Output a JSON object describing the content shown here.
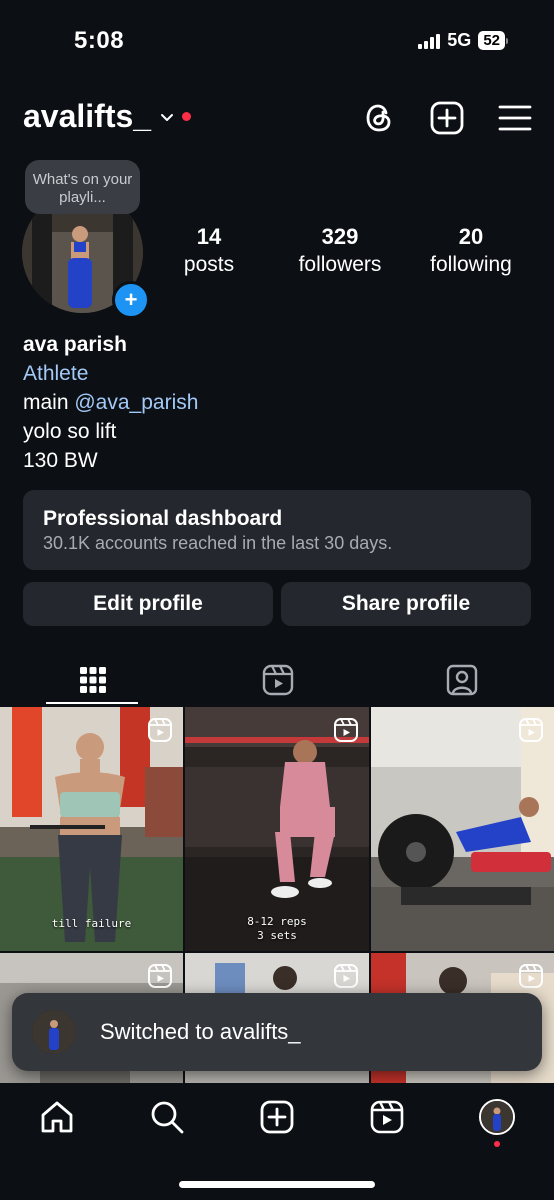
{
  "status_bar": {
    "time": "5:08",
    "network": "5G",
    "battery": "52"
  },
  "header": {
    "username": "avalifts_",
    "icons": [
      "threads-icon",
      "create-post-icon",
      "menu-icon"
    ]
  },
  "profile": {
    "note": "What's on your playli...",
    "stats": [
      {
        "value": "14",
        "label": "posts"
      },
      {
        "value": "329",
        "label": "followers"
      },
      {
        "value": "20",
        "label": "following"
      }
    ],
    "name": "ava parish",
    "category": "Athlete",
    "bio_main_prefix": "main ",
    "bio_mention": "@ava_parish",
    "bio_line2": "yolo so lift",
    "bio_line3": "130 BW"
  },
  "dashboard": {
    "title": "Professional dashboard",
    "subtitle": "30.1K accounts reached in the last 30 days."
  },
  "buttons": {
    "edit_profile": "Edit profile",
    "share_profile": "Share profile"
  },
  "tabs": [
    "grid-tab",
    "reels-tab",
    "tagged-tab"
  ],
  "grid": {
    "captions": {
      "tile1": "till failure",
      "tile2_line1": "8-12 reps",
      "tile2_line2": "3 sets"
    }
  },
  "toast": {
    "message": "Switched to avalifts_"
  },
  "bottom_nav": [
    "home-icon",
    "search-icon",
    "create-icon",
    "reels-icon",
    "profile-avatar"
  ],
  "colors": {
    "background": "#0c0f14",
    "accent_blue": "#1d94f3",
    "link": "#a3c9f7",
    "notification_red": "#ff2d46",
    "card": "#24272d"
  }
}
